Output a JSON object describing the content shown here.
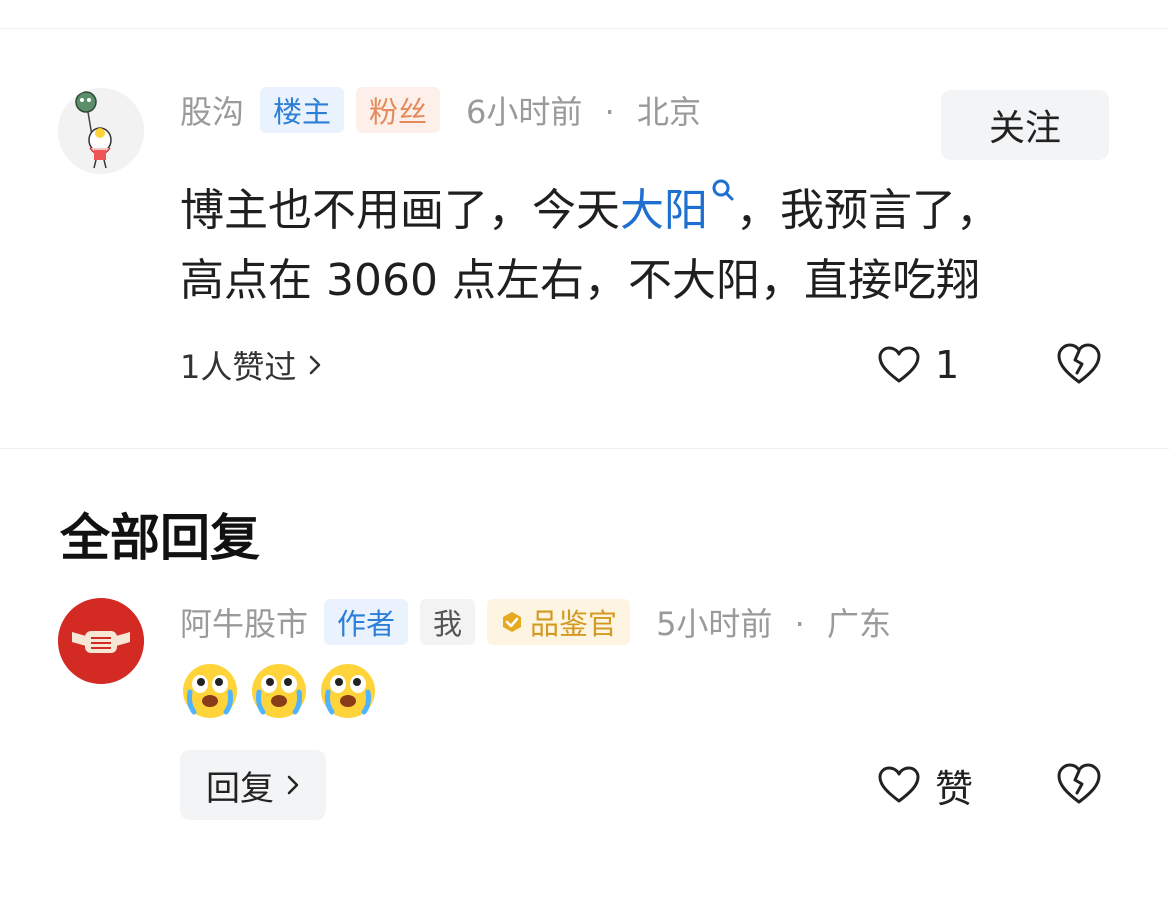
{
  "comment": {
    "username": "股沟",
    "badges": [
      "楼主",
      "粉丝"
    ],
    "time": "6小时前",
    "separator": "·",
    "location": "北京",
    "follow_label": "关注",
    "text_line1_prefix": "博主也不用画了，今天",
    "keyword": "大阳",
    "text_line1_suffix": "，我预言了，",
    "text_line2": "高点在 3060 点左右，不大阳，直接吃翔",
    "likers_label": "1人赞过",
    "like_count": "1",
    "icons": [
      "avatar-cartoon",
      "search-mini-icon",
      "chevron-right-icon",
      "heart-icon",
      "broken-heart-icon"
    ]
  },
  "replies_section": {
    "title": "全部回复",
    "reply": {
      "username": "阿牛股市",
      "badges": [
        "作者",
        "我",
        "品鉴官"
      ],
      "time": "5小时前",
      "separator": "·",
      "location": "广东",
      "emojis": [
        "crying-emoji",
        "crying-emoji",
        "crying-emoji"
      ],
      "reply_label": "回复",
      "like_label": "赞"
    }
  },
  "colors": {
    "link_blue": "#1d6fd0",
    "badge_blue": "#2c7ed6",
    "badge_orange": "#e58a5b",
    "badge_gold": "#d29a23",
    "avatar_red": "#d42a24",
    "muted_text": "#9a9a9a"
  }
}
